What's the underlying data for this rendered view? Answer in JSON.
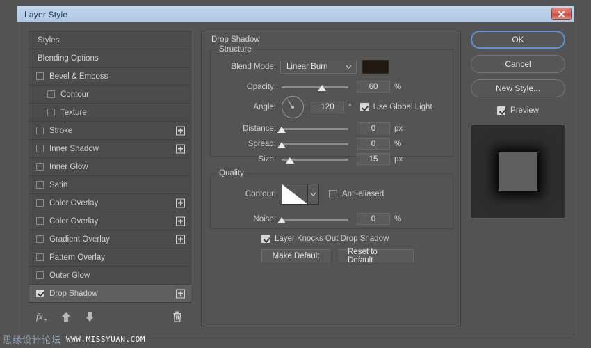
{
  "window": {
    "title": "Layer Style",
    "close_label": "x"
  },
  "sidebar": {
    "items": [
      {
        "label": "Styles",
        "type": "header",
        "checkbox": null,
        "plus": false,
        "selected": false
      },
      {
        "label": "Blending Options",
        "type": "header",
        "checkbox": null,
        "plus": false,
        "selected": false
      },
      {
        "label": "Bevel & Emboss",
        "type": "normal",
        "checkbox": false,
        "plus": false,
        "selected": false
      },
      {
        "label": "Contour",
        "type": "sub",
        "checkbox": false,
        "plus": false,
        "selected": false
      },
      {
        "label": "Texture",
        "type": "sub",
        "checkbox": false,
        "plus": false,
        "selected": false
      },
      {
        "label": "Stroke",
        "type": "normal",
        "checkbox": false,
        "plus": true,
        "selected": false
      },
      {
        "label": "Inner Shadow",
        "type": "normal",
        "checkbox": false,
        "plus": true,
        "selected": false
      },
      {
        "label": "Inner Glow",
        "type": "normal",
        "checkbox": false,
        "plus": false,
        "selected": false
      },
      {
        "label": "Satin",
        "type": "normal",
        "checkbox": false,
        "plus": false,
        "selected": false
      },
      {
        "label": "Color Overlay",
        "type": "normal",
        "checkbox": false,
        "plus": true,
        "selected": false
      },
      {
        "label": "Color Overlay",
        "type": "normal",
        "checkbox": false,
        "plus": true,
        "selected": false
      },
      {
        "label": "Gradient Overlay",
        "type": "normal",
        "checkbox": false,
        "plus": true,
        "selected": false
      },
      {
        "label": "Pattern Overlay",
        "type": "normal",
        "checkbox": false,
        "plus": false,
        "selected": false
      },
      {
        "label": "Outer Glow",
        "type": "normal",
        "checkbox": false,
        "plus": false,
        "selected": false
      },
      {
        "label": "Drop Shadow",
        "type": "normal",
        "checkbox": true,
        "plus": true,
        "selected": true
      }
    ],
    "toolbar": {
      "fx_icon": "fx-icon",
      "up_icon": "arrow-up-icon",
      "down_icon": "arrow-down-icon",
      "trash_icon": "trash-icon"
    }
  },
  "main": {
    "panel_title": "Drop Shadow",
    "structure": {
      "legend": "Structure",
      "blend_mode": {
        "label": "Blend Mode:",
        "value": "Linear Burn",
        "color": "#221a10"
      },
      "opacity": {
        "label": "Opacity:",
        "value": "60",
        "unit": "%",
        "slider_pct": 60
      },
      "angle": {
        "label": "Angle:",
        "value": "120",
        "unit": "°",
        "degrees": 120,
        "use_global_light": {
          "label": "Use Global Light",
          "checked": true
        }
      },
      "distance": {
        "label": "Distance:",
        "value": "0",
        "unit": "px",
        "slider_pct": 0
      },
      "spread": {
        "label": "Spread:",
        "value": "0",
        "unit": "%",
        "slider_pct": 0
      },
      "size": {
        "label": "Size:",
        "value": "15",
        "unit": "px",
        "slider_pct": 12
      }
    },
    "quality": {
      "legend": "Quality",
      "contour": {
        "label": "Contour:",
        "anti_aliased": {
          "label": "Anti-aliased",
          "checked": false
        }
      },
      "noise": {
        "label": "Noise:",
        "value": "0",
        "unit": "%",
        "slider_pct": 0
      }
    },
    "knockout": {
      "label": "Layer Knocks Out Drop Shadow",
      "checked": true
    },
    "make_default_label": "Make Default",
    "reset_default_label": "Reset to Default"
  },
  "right": {
    "ok_label": "OK",
    "cancel_label": "Cancel",
    "new_style_label": "New Style...",
    "preview": {
      "label": "Preview",
      "checked": true
    }
  },
  "watermark": {
    "cn": "思缘设计论坛",
    "en": "WWW.MISSYUAN.COM"
  }
}
